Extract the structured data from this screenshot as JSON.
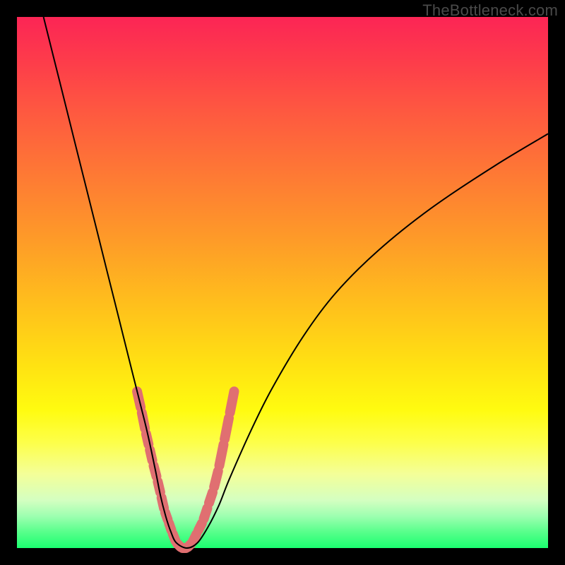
{
  "watermark": "TheBottleneck.com",
  "colors": {
    "background": "#000000",
    "curve": "#000000",
    "markers": "#e06f71"
  },
  "chart_data": {
    "type": "line",
    "title": "",
    "xlabel": "",
    "ylabel": "",
    "xlim": [
      0,
      100
    ],
    "ylim": [
      0,
      100
    ],
    "grid": false,
    "legend": false,
    "series": [
      {
        "name": "bottleneck-curve",
        "x": [
          5,
          8,
          11,
          14,
          17,
          19,
          21,
          23,
          24.5,
          26,
          27,
          28,
          29,
          30,
          32,
          34,
          36,
          38,
          40,
          44,
          48,
          54,
          60,
          68,
          78,
          90,
          100
        ],
        "y": [
          100,
          88,
          76,
          64,
          52,
          44,
          36,
          28,
          22,
          15,
          10,
          6,
          3,
          1,
          0,
          1,
          4,
          8,
          13,
          22,
          30,
          40,
          48,
          56,
          64,
          72,
          78
        ]
      }
    ],
    "markers": {
      "name": "highlight-points",
      "x": [
        22.5,
        23.4,
        24.2,
        24.9,
        25.6,
        26.4,
        27.1,
        27.8,
        28.5,
        29.2,
        30.0,
        31.0,
        32.0,
        33.0,
        34.0,
        35.0,
        36.0,
        37.0,
        38.0,
        39.0,
        40.0,
        41.0
      ],
      "y": [
        30,
        26,
        22,
        19,
        16,
        13,
        10,
        7,
        5,
        3,
        1,
        0,
        0,
        1,
        3,
        5,
        8,
        11,
        15,
        20,
        25,
        30
      ]
    },
    "note": "x is a normalized horizontal position (0-100, percent of plot width). y is a normalized bottleneck magnitude (0 at the bottom edge = green/optimal, 100 at the top edge = red/severe). The curve dips to ~0 near x≈31 indicating the optimal balance point; salmon markers highlight the near-optimal region around the minimum."
  }
}
